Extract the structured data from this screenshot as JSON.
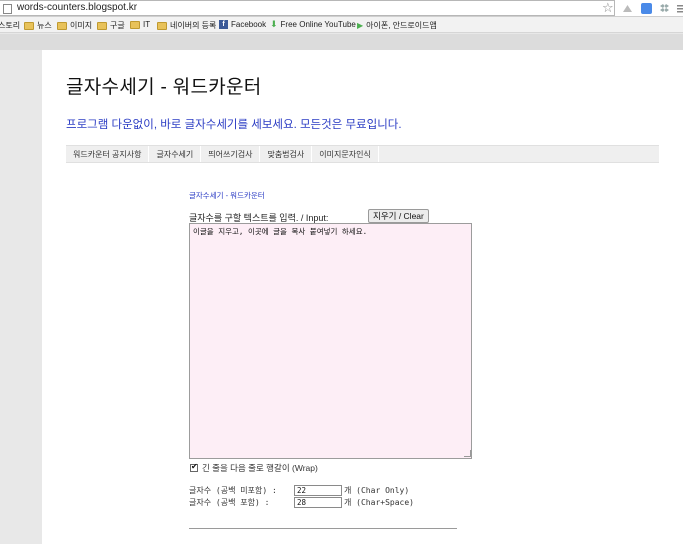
{
  "browser": {
    "url": "words-counters.blogspot.kr",
    "bookmarks": [
      "스토리",
      "뉴스",
      "이미지",
      "구글",
      "IT",
      "네이버의 등록",
      "Facebook",
      "Free Online YouTube",
      "아이폰, 안드로이드앱"
    ]
  },
  "page": {
    "title": "글자수세기 - 워드카운터",
    "subtitle": "프로그램 다운없이, 바로 글자수세기를 세보세요. 모든것은 무료입니다.",
    "nav": [
      "워드카운터 공지사항",
      "글자수세기",
      "띄어쓰기검사",
      "맞춤법검사",
      "이미지문자인식"
    ],
    "breadcrumb": "글자수세기 - 워드카운터",
    "input_label": "글자수를 구할 텍스트를 입력. / Input:",
    "clear_button": "지우기 / Clear",
    "textarea_value": "이글을 지우고, 이곳에 글을 복사 붙여넣기 하세요.",
    "wrap_label": "긴 줄을 다음 줄로 행갈이 (Wrap)",
    "wrap_checked": true,
    "counts": [
      {
        "label": "글자수 (공백 미포함)  :",
        "value": "22",
        "unit": "개 (Char Only)"
      },
      {
        "label": "글자수 (공백 포함)    :",
        "value": "28",
        "unit": "개 (Char+Space)"
      }
    ]
  },
  "colors": {
    "link_blue": "#2b3cc4",
    "textarea_bg": "#fdeef6"
  }
}
